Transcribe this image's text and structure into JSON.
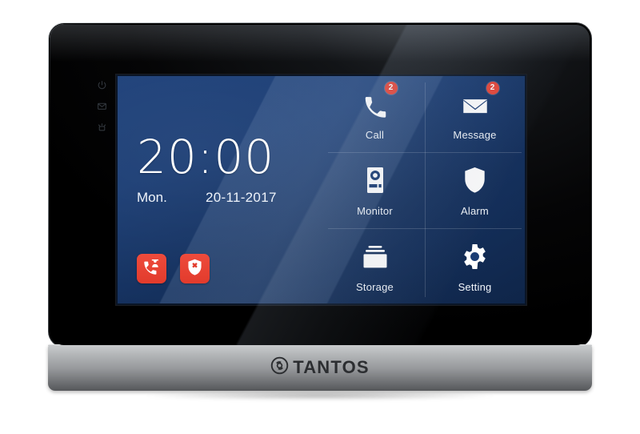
{
  "device": {
    "brand": "TANTOS",
    "brand_logo_icon": "tantos-swirl-logo-icon"
  },
  "bezel_keys": [
    {
      "name": "power-key",
      "icon": "power-icon"
    },
    {
      "name": "message-key",
      "icon": "envelope-icon"
    },
    {
      "name": "alarm-key",
      "icon": "siren-icon"
    }
  ],
  "screen": {
    "background_color": "#1b3d74",
    "clock": {
      "time": "20:00",
      "weekday": "Mon.",
      "date": "20-11-2017"
    },
    "quick_actions": [
      {
        "name": "call-concierge-button",
        "icon": "phone-guard-icon",
        "color": "#e8473a"
      },
      {
        "name": "disarm-alarm-button",
        "icon": "shield-cross-icon",
        "color": "#e8473a"
      }
    ],
    "menu": [
      {
        "name": "call",
        "label": "Call",
        "icon": "phone-handset-icon",
        "badge": "2"
      },
      {
        "name": "message",
        "label": "Message",
        "icon": "envelope-icon",
        "badge": "2"
      },
      {
        "name": "monitor",
        "label": "Monitor",
        "icon": "door-station-icon",
        "badge": ""
      },
      {
        "name": "alarm",
        "label": "Alarm",
        "icon": "shield-icon",
        "badge": ""
      },
      {
        "name": "storage",
        "label": "Storage",
        "icon": "storage-box-icon",
        "badge": ""
      },
      {
        "name": "setting",
        "label": "Setting",
        "icon": "gear-icon",
        "badge": ""
      }
    ],
    "badge_color": "#e8473a"
  }
}
